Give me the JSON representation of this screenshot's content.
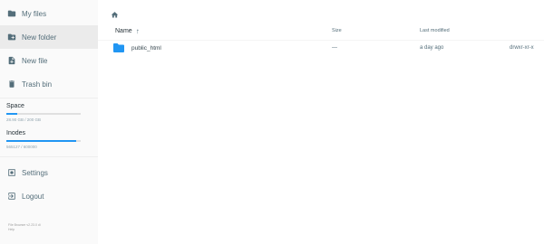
{
  "sidebar": {
    "items": [
      {
        "label": "My files",
        "icon": "folder-icon"
      },
      {
        "label": "New folder",
        "icon": "create-folder-icon"
      },
      {
        "label": "New file",
        "icon": "note-add-icon"
      },
      {
        "label": "Trash bin",
        "icon": "delete-icon"
      }
    ],
    "space": {
      "label": "Space",
      "value": "28.90 GB / 200 GB",
      "fraction": 0.1445
    },
    "inodes": {
      "label": "Inodes",
      "value": "565127 / 600000",
      "fraction": 0.942
    },
    "settings_label": "Settings",
    "logout_label": "Logout",
    "credit_line1": "File Browser v2.23.0 di",
    "credit_line2": "Help"
  },
  "main": {
    "columns": {
      "name": "Name",
      "size": "Size",
      "modified": "Last modified"
    },
    "rows": [
      {
        "name": "public_html",
        "size": "—",
        "modified": "a day ago",
        "permissions": "drwxr-xr-x"
      }
    ]
  },
  "colors": {
    "accent": "#2196f3",
    "text": "#546e7a"
  }
}
